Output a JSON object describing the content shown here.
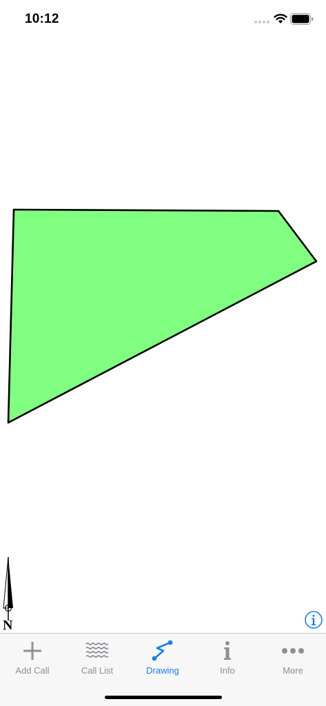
{
  "status_bar": {
    "time": "10:12",
    "icons": [
      "cellular-signal-icon",
      "wifi-icon",
      "battery-icon"
    ]
  },
  "drawing": {
    "shape": "quadrilateral",
    "fill_color": "#80ff80",
    "stroke_color": "#000000"
  },
  "north_arrow": {
    "label": "N"
  },
  "info_button": {
    "icon": "info-circle-icon",
    "color": "#1a7cf0"
  },
  "tab_bar": {
    "active_color": "#1a7cf0",
    "inactive_color": "#8e8e93",
    "tabs": [
      {
        "label": "Add Call",
        "icon": "plus-icon",
        "active": false
      },
      {
        "label": "Call List",
        "icon": "wavy-lines-icon",
        "active": false
      },
      {
        "label": "Drawing",
        "icon": "polyline-icon",
        "active": true
      },
      {
        "label": "Info",
        "icon": "info-icon",
        "active": false
      },
      {
        "label": "More",
        "icon": "more-dots-icon",
        "active": false
      }
    ]
  }
}
